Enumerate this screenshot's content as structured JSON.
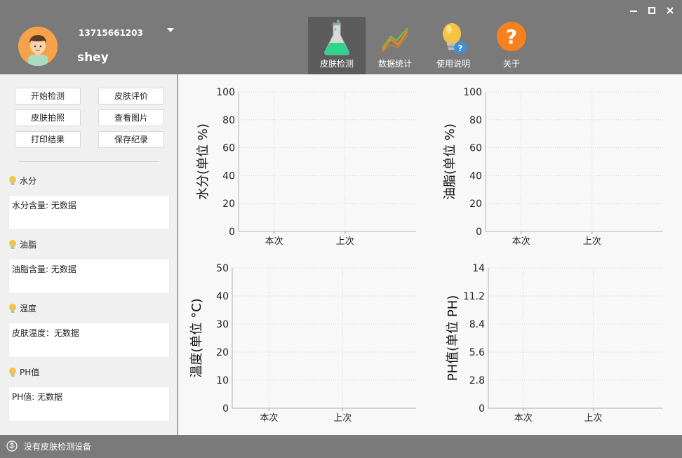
{
  "header": {
    "phone": "13715661203",
    "username": "shey",
    "nav": [
      {
        "label": "皮肤检测",
        "icon": "flask-icon",
        "active": true
      },
      {
        "label": "数据统计",
        "icon": "line-chart-icon",
        "active": false
      },
      {
        "label": "使用说明",
        "icon": "lightbulb-help-icon",
        "active": false
      },
      {
        "label": "关于",
        "icon": "question-mark-icon",
        "active": false
      }
    ]
  },
  "sidebar": {
    "buttons": {
      "start": "开始检测",
      "evaluate": "皮肤评价",
      "photo": "皮肤拍照",
      "view_images": "查看图片",
      "print": "打印结果",
      "save": "保存纪录"
    },
    "sections": [
      {
        "title": "水分",
        "content": "水分含量: 无数据"
      },
      {
        "title": "油脂",
        "content": "油脂含量: 无数据"
      },
      {
        "title": "温度",
        "content": "皮肤温度：无数据"
      },
      {
        "title": "PH值",
        "content": "PH值: 无数据"
      }
    ]
  },
  "colors": {
    "header_bg": "#7a7a7a",
    "nav_active_bg": "#5c5c5c",
    "sidebar_bg": "#f0f0f0",
    "chart_bg": "#f8f8f8",
    "accent_orange": "#f5821f",
    "bulb_yellow": "#f6c445"
  },
  "chart_data": [
    {
      "type": "bar",
      "ylabel": "水分(单位  %)",
      "categories": [
        "本次",
        "上次"
      ],
      "series": [],
      "ylim": [
        0,
        100
      ],
      "yticks": [
        "0",
        "20",
        "40",
        "60",
        "80",
        "100"
      ],
      "grid": true
    },
    {
      "type": "bar",
      "ylabel": "油脂(单位  %)",
      "categories": [
        "本次",
        "上次"
      ],
      "series": [],
      "ylim": [
        0,
        100
      ],
      "yticks": [
        "0",
        "20",
        "40",
        "60",
        "80",
        "100"
      ],
      "grid": true
    },
    {
      "type": "bar",
      "ylabel": "温度(单位  °C)",
      "categories": [
        "本次",
        "上次"
      ],
      "series": [],
      "ylim": [
        0,
        50
      ],
      "yticks": [
        "0",
        "10",
        "20",
        "30",
        "40",
        "50"
      ],
      "grid": true
    },
    {
      "type": "bar",
      "ylabel": "PH值(单位  PH)",
      "categories": [
        "本次",
        "上次"
      ],
      "series": [],
      "ylim": [
        0,
        14
      ],
      "yticks": [
        "0",
        "2.8",
        "5.6",
        "8.4",
        "11.2",
        "14"
      ],
      "grid": true
    }
  ],
  "status": {
    "text": "没有皮肤检测设备",
    "icon": "usb-icon"
  }
}
